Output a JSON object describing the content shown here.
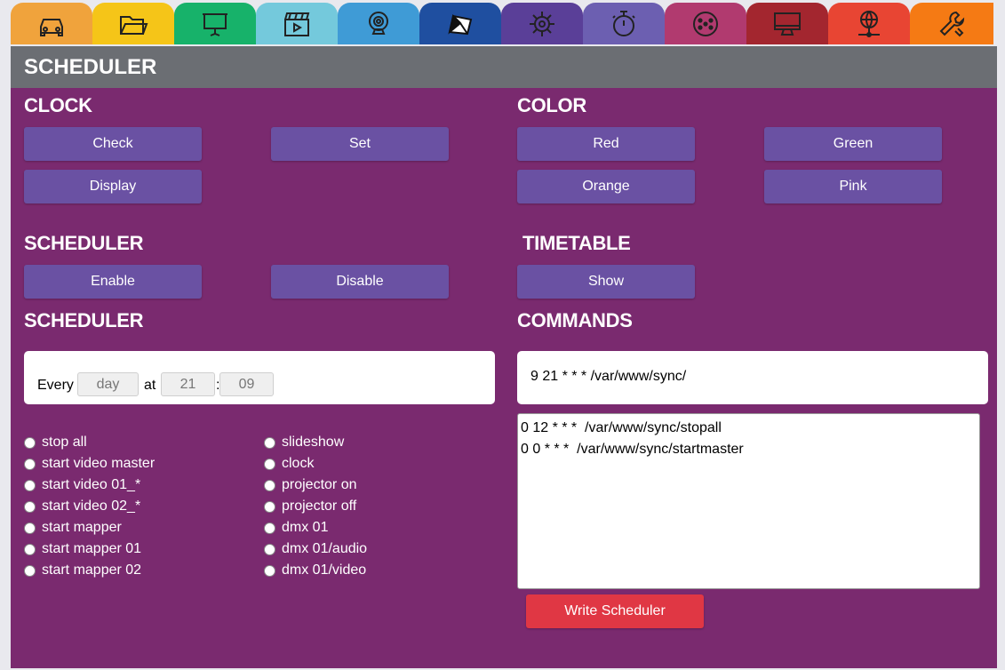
{
  "tabs": [
    {
      "icon": "car-icon",
      "color": "#f0a33c"
    },
    {
      "icon": "folder-icon",
      "color": "#f5c518"
    },
    {
      "icon": "projector-screen-icon",
      "color": "#17b26a"
    },
    {
      "icon": "clapperboard-icon",
      "color": "#74c9dc"
    },
    {
      "icon": "webcam-icon",
      "color": "#3f9bd6"
    },
    {
      "icon": "mapping-icon",
      "color": "#1f4fa0"
    },
    {
      "icon": "chip-icon",
      "color": "#5a3f98"
    },
    {
      "icon": "stopwatch-icon",
      "color": "#6c5fb1"
    },
    {
      "icon": "dmx-connector-icon",
      "color": "#b13a6f"
    },
    {
      "icon": "monitor-icon",
      "color": "#a3262f"
    },
    {
      "icon": "network-globe-icon",
      "color": "#e84533"
    },
    {
      "icon": "wrench-icon",
      "color": "#f57a14"
    }
  ],
  "page_title": "SCHEDULER",
  "clock": {
    "heading": "CLOCK",
    "check": "Check",
    "set": "Set",
    "display": "Display"
  },
  "color": {
    "heading": "COLOR",
    "red": "Red",
    "green": "Green",
    "orange": "Orange",
    "pink": "Pink"
  },
  "scheduler_toggle": {
    "heading": "SCHEDULER",
    "enable": "Enable",
    "disable": "Disable"
  },
  "timetable": {
    "heading": "TIMETABLE",
    "show": "Show"
  },
  "scheduler_form": {
    "heading": "SCHEDULER",
    "every_label": "Every",
    "day_placeholder": "day",
    "at_label": "at",
    "hour_placeholder": "21",
    "colon": ":",
    "minute_placeholder": "09"
  },
  "actions_left": [
    "stop all",
    "start video master",
    "start video 01_*",
    "start video 02_*",
    "start mapper",
    "start mapper 01",
    "start mapper 02"
  ],
  "actions_right": [
    "slideshow",
    "clock",
    "projector on",
    "projector off",
    "dmx 01",
    "dmx 01/audio",
    "dmx 01/video"
  ],
  "commands": {
    "heading": "COMMANDS",
    "preview": "9 21 * * * /var/www/sync/",
    "list": "0 12 * * *  /var/www/sync/stopall\n0 0 * * *  /var/www/sync/startmaster",
    "write_button": "Write Scheduler"
  }
}
